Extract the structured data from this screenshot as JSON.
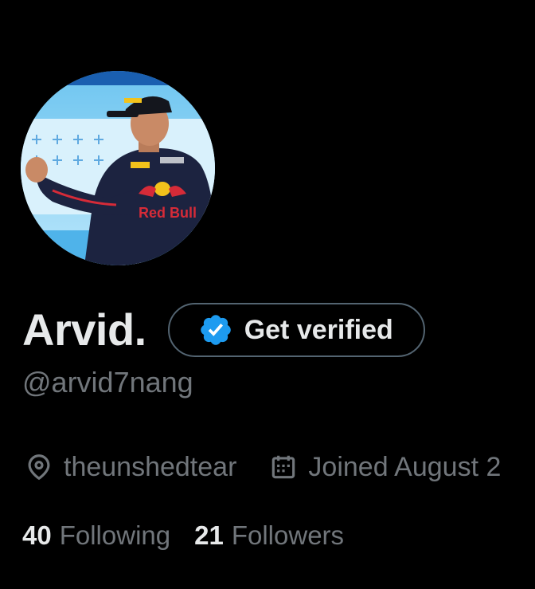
{
  "profile": {
    "display_name": "Arvid.",
    "handle": "@arvid7nang",
    "location": "theunshedtear",
    "joined": "Joined August 2",
    "following_count": "40",
    "following_label": "Following",
    "followers_count": "21",
    "followers_label": "Followers"
  },
  "verify_button": {
    "label": "Get verified"
  },
  "avatar": {
    "shirt_text": "Red Bull"
  },
  "icons": {
    "verified_badge": "verified-badge-icon",
    "location": "location-pin-icon",
    "calendar": "calendar-icon"
  },
  "colors": {
    "background": "#000000",
    "primary_text": "#e7e9ea",
    "secondary_text": "#71767b",
    "border": "#536471",
    "verified_blue": "#1d9bf0"
  }
}
